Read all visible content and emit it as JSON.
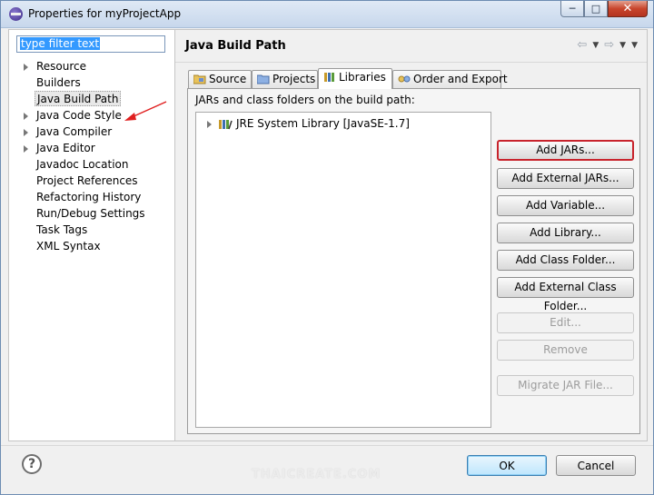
{
  "window": {
    "title": "Properties for myProjectApp",
    "icon": "eclipse-icon",
    "controls": [
      "minimize-icon",
      "maximize-icon",
      "close-icon"
    ]
  },
  "filter": {
    "value": "type filter text"
  },
  "tree": {
    "items": [
      {
        "label": "Resource",
        "expandable": true
      },
      {
        "label": "Builders",
        "expandable": false
      },
      {
        "label": "Java Build Path",
        "expandable": false,
        "selected": true
      },
      {
        "label": "Java Code Style",
        "expandable": true
      },
      {
        "label": "Java Compiler",
        "expandable": true
      },
      {
        "label": "Java Editor",
        "expandable": true
      },
      {
        "label": "Javadoc Location",
        "expandable": false
      },
      {
        "label": "Project References",
        "expandable": false
      },
      {
        "label": "Refactoring History",
        "expandable": false
      },
      {
        "label": "Run/Debug Settings",
        "expandable": false
      },
      {
        "label": "Task Tags",
        "expandable": false
      },
      {
        "label": "XML Syntax",
        "expandable": false
      }
    ]
  },
  "page": {
    "title": "Java Build Path",
    "tabs": [
      {
        "label": "Source",
        "icon": "source-folder-icon"
      },
      {
        "label": "Projects",
        "icon": "projects-folder-icon"
      },
      {
        "label": "Libraries",
        "icon": "library-icon",
        "active": true
      },
      {
        "label": "Order and Export",
        "icon": "order-export-icon"
      }
    ],
    "libraries_label": "JARs and class folders on the build path:",
    "libraries": [
      {
        "label": "JRE System Library [JavaSE-1.7]",
        "icon": "library-icon"
      }
    ],
    "buttons": [
      {
        "label": "Add JARs...",
        "enabled": true,
        "highlighted": true
      },
      {
        "label": "Add External JARs...",
        "enabled": true
      },
      {
        "label": "Add Variable...",
        "enabled": true
      },
      {
        "label": "Add Library...",
        "enabled": true
      },
      {
        "label": "Add Class Folder...",
        "enabled": true
      },
      {
        "label": "Add External Class Folder...",
        "enabled": true
      },
      {
        "label": "Edit...",
        "enabled": false
      },
      {
        "label": "Remove",
        "enabled": false
      },
      {
        "label": "Migrate JAR File...",
        "enabled": false
      }
    ]
  },
  "footer": {
    "help_label": "?",
    "ok_label": "OK",
    "cancel_label": "Cancel",
    "watermark": "THAICREATE.COM"
  },
  "colors": {
    "highlight_border": "#c8232c",
    "annotation_arrow": "#e02020",
    "selection": "#3399ff"
  }
}
